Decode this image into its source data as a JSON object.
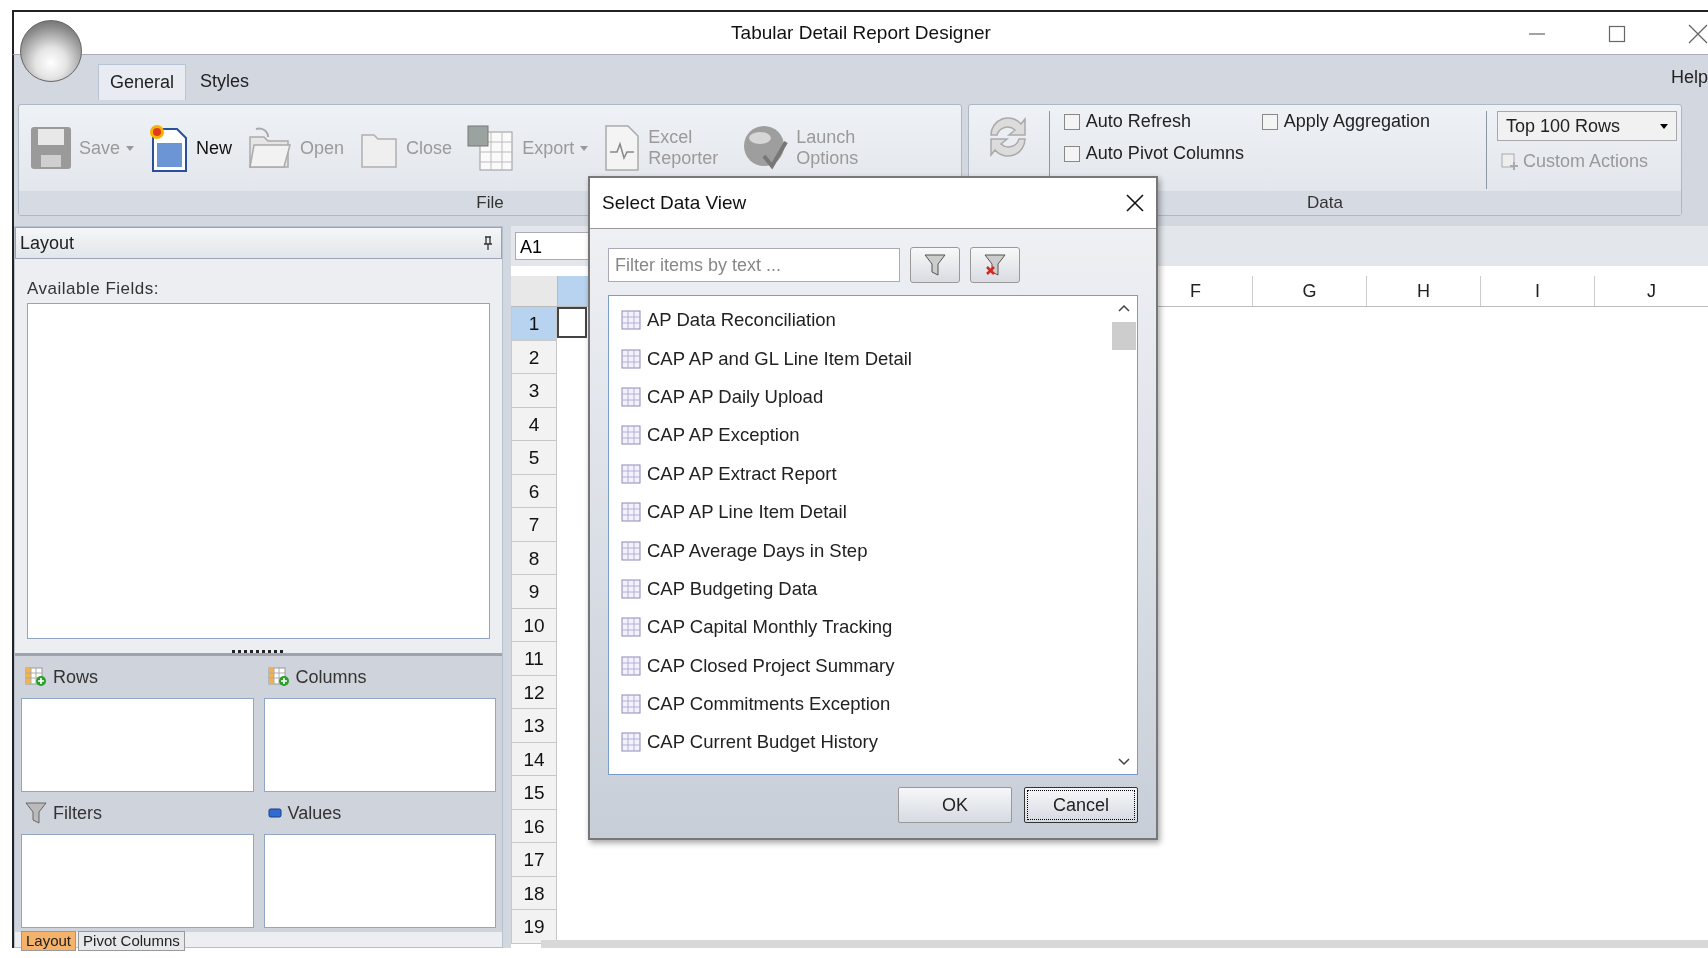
{
  "window": {
    "title": "Tabular Detail Report Designer"
  },
  "ribbon_tabs": [
    {
      "label": "General",
      "selected": true
    },
    {
      "label": "Styles",
      "selected": false
    }
  ],
  "help": "Help",
  "file_group": {
    "label": "File",
    "buttons": [
      {
        "kind": "save",
        "label": "Save",
        "disabled": true,
        "dropdown": true
      },
      {
        "kind": "new",
        "label": "New",
        "disabled": false,
        "dropdown": false
      },
      {
        "kind": "open",
        "label": "Open",
        "disabled": true,
        "dropdown": false
      },
      {
        "kind": "close",
        "label": "Close",
        "disabled": true,
        "dropdown": false
      },
      {
        "kind": "export",
        "label": "Export",
        "disabled": true,
        "dropdown": true
      },
      {
        "kind": "excel",
        "label": "Excel Reporter",
        "disabled": true,
        "dropdown": false
      },
      {
        "kind": "launch",
        "label": "Launch Options",
        "disabled": true,
        "dropdown": false
      }
    ]
  },
  "data_group": {
    "label": "Data",
    "checkboxes": [
      {
        "label": "Auto Refresh",
        "checked": false
      },
      {
        "label": "Auto Pivot Columns",
        "checked": false
      },
      {
        "label": "Apply Aggregation",
        "checked": false
      }
    ],
    "rows_dropdown": "Top 100 Rows",
    "custom_actions": {
      "label": "Custom Actions",
      "disabled": true
    }
  },
  "layout_panel": {
    "title": "Layout",
    "available_fields_label": "Available Fields:",
    "zones": [
      {
        "kind": "rows",
        "label": "Rows"
      },
      {
        "kind": "columns",
        "label": "Columns"
      },
      {
        "kind": "filters",
        "label": "Filters"
      },
      {
        "kind": "values",
        "label": "Values"
      }
    ],
    "bottom_tabs": [
      {
        "label": "Layout",
        "selected": true
      },
      {
        "label": "Pivot Columns",
        "selected": false
      }
    ]
  },
  "grid": {
    "name_box": "A1",
    "columns": [
      "F",
      "G",
      "H",
      "I",
      "J"
    ],
    "rows": [
      {
        "label": "1",
        "selected": true
      },
      {
        "label": "2",
        "selected": false
      },
      {
        "label": "3",
        "selected": false
      },
      {
        "label": "4",
        "selected": false
      },
      {
        "label": "5",
        "selected": false
      },
      {
        "label": "6",
        "selected": false
      },
      {
        "label": "7",
        "selected": false
      },
      {
        "label": "8",
        "selected": false
      },
      {
        "label": "9",
        "selected": false
      },
      {
        "label": "10",
        "selected": false
      },
      {
        "label": "11",
        "selected": false
      },
      {
        "label": "12",
        "selected": false
      },
      {
        "label": "13",
        "selected": false
      },
      {
        "label": "14",
        "selected": false
      },
      {
        "label": "15",
        "selected": false
      },
      {
        "label": "16",
        "selected": false
      },
      {
        "label": "17",
        "selected": false
      },
      {
        "label": "18",
        "selected": false
      },
      {
        "label": "19",
        "selected": false
      }
    ]
  },
  "dialog": {
    "title": "Select Data View",
    "filter": {
      "placeholder": "Filter items by text ..."
    },
    "items": [
      "AP Data Reconciliation",
      "CAP AP and GL Line Item Detail",
      "CAP AP Daily Upload",
      "CAP AP Exception",
      "CAP AP Extract Report",
      "CAP AP Line Item Detail",
      "CAP Average Days in Step",
      "CAP Budgeting Data",
      "CAP Capital Monthly Tracking",
      "CAP Closed Project Summary",
      "CAP Commitments Exception",
      "CAP Current Budget History"
    ],
    "buttons": [
      {
        "label": "OK",
        "default": false
      },
      {
        "label": "Cancel",
        "default": true
      }
    ]
  }
}
